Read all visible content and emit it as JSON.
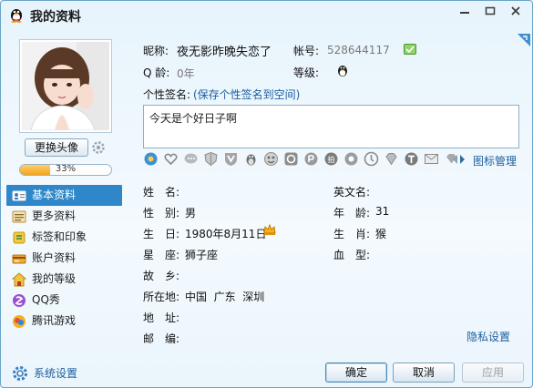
{
  "window": {
    "title": "我的资料"
  },
  "left": {
    "change_avatar": "更换头像",
    "progress_percent": 33,
    "progress_text": "33%",
    "nav": [
      {
        "label": "基本资料",
        "icon": "id-card-icon"
      },
      {
        "label": "更多资料",
        "icon": "list-icon"
      },
      {
        "label": "标签和印象",
        "icon": "tag-icon"
      },
      {
        "label": "账户资料",
        "icon": "account-icon"
      },
      {
        "label": "我的等级",
        "icon": "level-icon"
      },
      {
        "label": "QQ秀",
        "icon": "qqshow-icon"
      },
      {
        "label": "腾讯游戏",
        "icon": "game-icon"
      }
    ],
    "system_settings": "系统设置"
  },
  "profile": {
    "nickname_label": "昵称:",
    "nickname": "夜无影昨晚失恋了",
    "account_label": "帐号:",
    "account": "528644117",
    "qage_label": "Q 龄:",
    "qage": "0年",
    "level_label": "等级:",
    "signature_label": "个性签名:",
    "signature_link": "(保存个性签名到空间)",
    "signature": "今天是个好日子啊",
    "icon_manage": "图标管理"
  },
  "details": {
    "name_label": "姓　名:",
    "name": "",
    "english_name_label": "英文名:",
    "english_name": "",
    "gender_label": "性　别:",
    "gender": "男",
    "age_label": "年　龄:",
    "age": "31",
    "birthday_label": "生　日:",
    "birthday": "1980年8月11日",
    "zodiac_label": "生　肖:",
    "zodiac": "猴",
    "constellation_label": "星　座:",
    "constellation": "狮子座",
    "blood_label": "血　型:",
    "blood": "",
    "hometown_label": "故　乡:",
    "hometown": "",
    "location_label": "所在地:",
    "location": "中国  广东  深圳",
    "address_label": "地　址:",
    "address": "",
    "postcode_label": "邮　编:",
    "postcode": "",
    "privacy": "隐私设置"
  },
  "buttons": {
    "ok": "确定",
    "cancel": "取消",
    "apply": "应用"
  },
  "colors": {
    "accent": "#2f87c9",
    "link": "#1b5e9e",
    "progress": "#f3a41e"
  }
}
